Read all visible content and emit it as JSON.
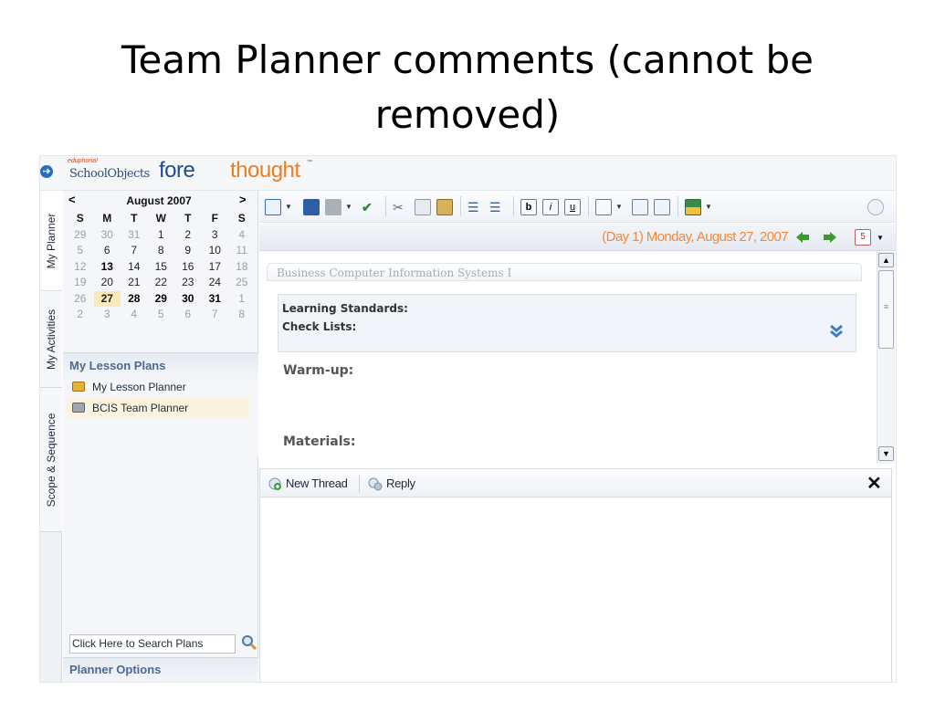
{
  "slide": {
    "title": "Team Planner comments (cannot be removed)"
  },
  "app": {
    "logo": {
      "edu": "eduphoria!",
      "schoolobjects": "SchoolObjects",
      "fore": "fore",
      "thought": "thought",
      "tm": "™"
    },
    "colors": {
      "accent_orange": "#ef8a3e",
      "brand_blue": "#1f4d8f",
      "section_blue": "#4b6a92"
    }
  },
  "tabs": {
    "my_planner": "My Planner",
    "my_activities": "My Activities",
    "scope_sequence": "Scope & Sequence"
  },
  "calendar": {
    "prev": "<",
    "next": ">",
    "month": "August 2007",
    "dow": [
      "S",
      "M",
      "T",
      "W",
      "T",
      "F",
      "S"
    ],
    "weeks": [
      [
        {
          "d": "29",
          "s": "other"
        },
        {
          "d": "30",
          "s": "other"
        },
        {
          "d": "31",
          "s": "other"
        },
        {
          "d": "1",
          "s": ""
        },
        {
          "d": "2",
          "s": ""
        },
        {
          "d": "3",
          "s": ""
        },
        {
          "d": "4",
          "s": "other"
        }
      ],
      [
        {
          "d": "5",
          "s": "other"
        },
        {
          "d": "6",
          "s": ""
        },
        {
          "d": "7",
          "s": ""
        },
        {
          "d": "8",
          "s": ""
        },
        {
          "d": "9",
          "s": ""
        },
        {
          "d": "10",
          "s": ""
        },
        {
          "d": "11",
          "s": "other"
        }
      ],
      [
        {
          "d": "12",
          "s": "other"
        },
        {
          "d": "13",
          "s": "bold"
        },
        {
          "d": "14",
          "s": ""
        },
        {
          "d": "15",
          "s": ""
        },
        {
          "d": "16",
          "s": ""
        },
        {
          "d": "17",
          "s": ""
        },
        {
          "d": "18",
          "s": "other"
        }
      ],
      [
        {
          "d": "19",
          "s": "other"
        },
        {
          "d": "20",
          "s": ""
        },
        {
          "d": "21",
          "s": ""
        },
        {
          "d": "22",
          "s": ""
        },
        {
          "d": "23",
          "s": ""
        },
        {
          "d": "24",
          "s": ""
        },
        {
          "d": "25",
          "s": "other"
        }
      ],
      [
        {
          "d": "26",
          "s": "other"
        },
        {
          "d": "27",
          "s": "today"
        },
        {
          "d": "28",
          "s": "bold"
        },
        {
          "d": "29",
          "s": "bold"
        },
        {
          "d": "30",
          "s": "bold"
        },
        {
          "d": "31",
          "s": "bold"
        },
        {
          "d": "1",
          "s": "other"
        }
      ],
      [
        {
          "d": "2",
          "s": "other"
        },
        {
          "d": "3",
          "s": "other"
        },
        {
          "d": "4",
          "s": "other"
        },
        {
          "d": "5",
          "s": "other"
        },
        {
          "d": "6",
          "s": "other"
        },
        {
          "d": "7",
          "s": "other"
        },
        {
          "d": "8",
          "s": "other"
        }
      ]
    ]
  },
  "lesson_plans": {
    "title": "My Lesson Plans",
    "items": [
      "My Lesson Planner",
      "BCIS Team Planner"
    ]
  },
  "search": {
    "value": "Click Here to Search Plans"
  },
  "planner_options": {
    "label": "Planner Options"
  },
  "datebar": {
    "date": "(Day 1) Monday, August 27, 2007"
  },
  "editor": {
    "course": "Business Computer Information Systems I",
    "learning_standards": "Learning Standards:",
    "check_lists": "Check Lists:",
    "warmup": "Warm-up:",
    "materials": "Materials:"
  },
  "comments": {
    "new_thread": "New Thread",
    "reply": "Reply",
    "close": "✕"
  }
}
